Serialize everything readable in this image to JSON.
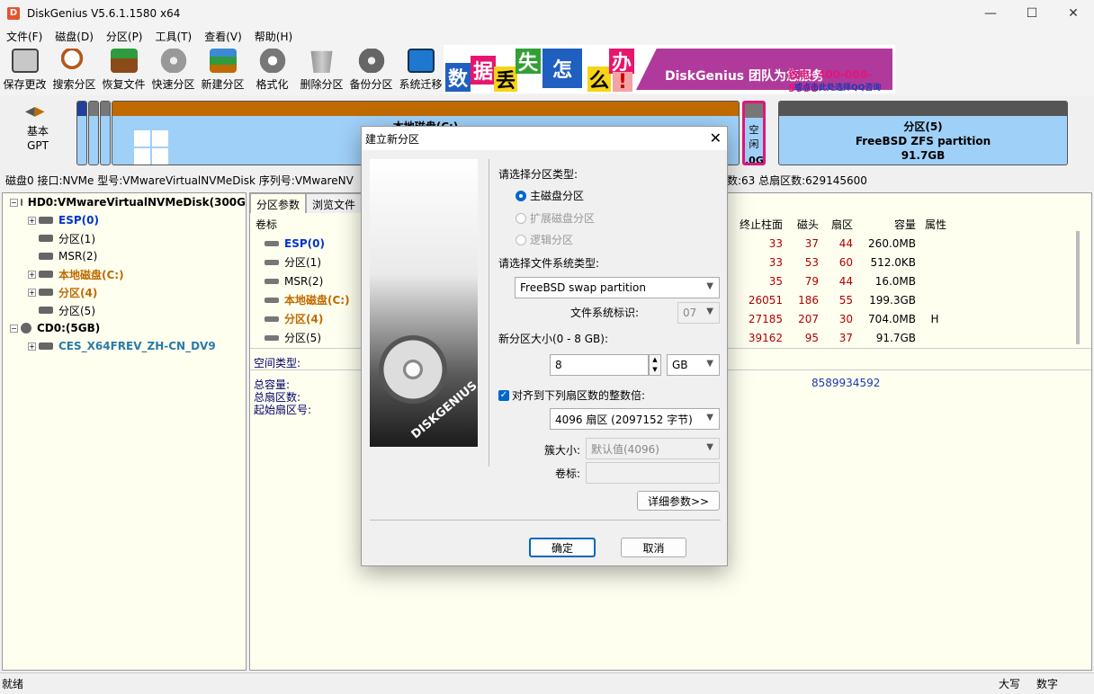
{
  "app": {
    "title": "DiskGenius V5.6.1.1580 x64"
  },
  "menu": [
    "文件(F)",
    "磁盘(D)",
    "分区(P)",
    "工具(T)",
    "查看(V)",
    "帮助(H)"
  ],
  "toolbar": [
    {
      "label": "保存更改",
      "icon": "save-disk-icon"
    },
    {
      "label": "搜索分区",
      "icon": "magnifier-icon"
    },
    {
      "label": "恢复文件",
      "icon": "recover-box-icon"
    },
    {
      "label": "快速分区",
      "icon": "quick-partition-icon"
    },
    {
      "label": "新建分区",
      "icon": "new-partition-icon"
    },
    {
      "label": "格式化",
      "icon": "format-gear-icon"
    },
    {
      "label": "删除分区",
      "icon": "trash-icon"
    },
    {
      "label": "备份分区",
      "icon": "backup-icon"
    },
    {
      "label": "系统迁移",
      "icon": "migrate-icon"
    }
  ],
  "ad": {
    "chars": [
      "数",
      "据",
      "丢",
      "失",
      "怎",
      "么",
      "办",
      "!"
    ],
    "banner_text": "DiskGenius 团队为您服务",
    "phone": "致电: 400-008-9958",
    "qq": "或点击此处选择QQ咨询"
  },
  "diskmap": {
    "basic": "基本",
    "gpt": "GPT",
    "segments": [
      {
        "name": "本地磁盘(C:)"
      },
      {
        "name": "空闲",
        "size": ".0G"
      },
      {
        "name": "分区(5)",
        "fs": "FreeBSD ZFS partition",
        "size": "91.7GB"
      }
    ]
  },
  "disk_info": {
    "left": "磁盘0 接口:NVMe 型号:VMwareVirtualNVMeDisk 序列号:VMwareNV",
    "right": "数:63 总扇区数:629145600"
  },
  "tree": {
    "disk": "HD0:VMwareVirtualNVMeDisk(300G",
    "partitions": [
      "ESP(0)",
      "分区(1)",
      "MSR(2)",
      "本地磁盘(C:)",
      "分区(4)",
      "分区(5)"
    ],
    "cd": "CD0:(5GB)",
    "cd_child": "CES_X64FREV_ZH-CN_DV9"
  },
  "tabs": [
    "分区参数",
    "浏览文件"
  ],
  "table": {
    "headers": [
      "卷标",
      "终止柱面",
      "磁头",
      "扇区",
      "容量",
      "属性"
    ],
    "rows": [
      {
        "name": "ESP(0)",
        "end_cyl": "33",
        "head": "37",
        "sector": "44",
        "capacity": "260.0MB",
        "attr": ""
      },
      {
        "name": "分区(1)",
        "end_cyl": "33",
        "head": "53",
        "sector": "60",
        "capacity": "512.0KB",
        "attr": ""
      },
      {
        "name": "MSR(2)",
        "end_cyl": "35",
        "head": "79",
        "sector": "44",
        "capacity": "16.0MB",
        "attr": ""
      },
      {
        "name": "本地磁盘(C:)",
        "end_cyl": "26051",
        "head": "186",
        "sector": "55",
        "capacity": "199.3GB",
        "attr": ""
      },
      {
        "name": "分区(4)",
        "end_cyl": "27185",
        "head": "207",
        "sector": "30",
        "capacity": "704.0MB",
        "attr": "H"
      },
      {
        "name": "分区(5)",
        "end_cyl": "39162",
        "head": "95",
        "sector": "37",
        "capacity": "91.7GB",
        "attr": ""
      }
    ]
  },
  "details": {
    "space_type": "空间类型:",
    "total_capacity": "总容量:",
    "total_sectors": "总扇区数:",
    "start_sector": "起始扇区号:",
    "value": "8589934592"
  },
  "status": {
    "left": "就绪",
    "caps": "大写",
    "num": "数字"
  },
  "dialog": {
    "title": "建立新分区",
    "image_text": "DISKGENIUS",
    "type_label": "请选择分区类型:",
    "types": [
      {
        "label": "主磁盘分区",
        "selected": true,
        "enabled": true
      },
      {
        "label": "扩展磁盘分区",
        "selected": false,
        "enabled": false
      },
      {
        "label": "逻辑分区",
        "selected": false,
        "enabled": false
      }
    ],
    "fs_label": "请选择文件系统类型:",
    "fs_value": "FreeBSD swap partition",
    "fs_id_label": "文件系统标识:",
    "fs_id_value": "07",
    "size_label": "新分区大小(0 - 8 GB):",
    "size_value": "8",
    "size_unit": "GB",
    "align_label": "对齐到下列扇区数的整数倍:",
    "align_checked": true,
    "align_value": "4096 扇区 (2097152 字节)",
    "cluster_label": "簇大小:",
    "cluster_value": "默认值(4096)",
    "volume_label": "卷标:",
    "volume_value": "",
    "details_button": "详细参数>>",
    "ok": "确定",
    "cancel": "取消"
  }
}
